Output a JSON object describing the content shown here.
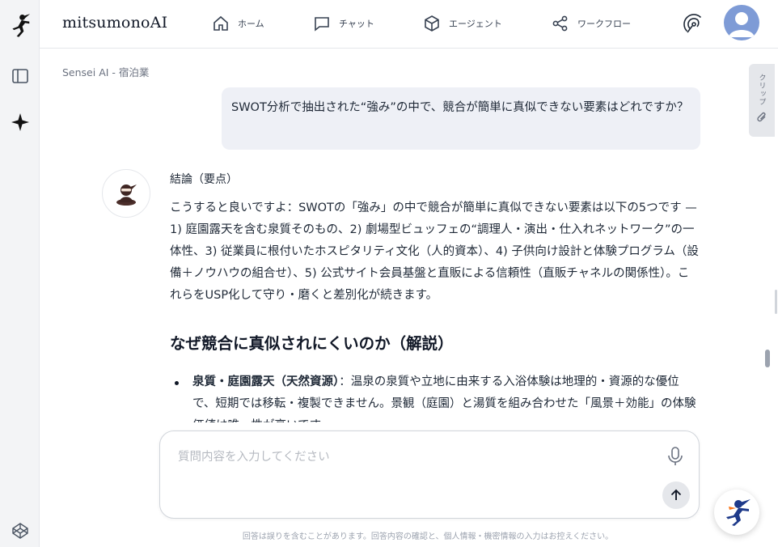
{
  "app": {
    "brand": "mitsumonoAI"
  },
  "nav": [
    {
      "label": "ホーム",
      "icon": "home-icon"
    },
    {
      "label": "チャット",
      "icon": "chat-icon"
    },
    {
      "label": "エージェント",
      "icon": "cube-icon"
    },
    {
      "label": "ワークフロー",
      "icon": "share-nodes-icon"
    }
  ],
  "breadcrumb": "Sensei AI - 宿泊業",
  "clip_tab": {
    "label": "クリップ"
  },
  "user_message": "SWOT分析で抽出された“強み”の中で、競合が簡単に真似できない要素はどれですか？",
  "answer": {
    "lead": "結論（要点）",
    "paragraph": "こうすると良いですよ：SWOTの「強み」の中で競合が簡単に真似できない要素は以下の5つです — 1) 庭園露天を含む泉質そのもの、2) 劇場型ビュッフェの“調理人・演出・仕入れネットワーク”の一体性、3) 従業員に根付いたホスピタリティ文化（人的資本）、4) 子供向け設計と体験プログラム（設備＋ノウハウの組合せ）、5) 公式サイト会員基盤と直販による信頼性（直販チャネルの関係性）。これらをUSP化して守り・磨くと差別化が続きます。",
    "heading": "なぜ競合に真似されにくいのか（解説）",
    "bullets": [
      {
        "title": "泉質・庭園露天（天然資源）",
        "text": "：温泉の泉質や立地に由来する入浴体験は地理的・資源的な優位で、短期では移転・複製できません。景観（庭園）と湯質を組み合わせた「風景＋効能」の体験価値は唯一性が高いです。"
      }
    ]
  },
  "composer": {
    "placeholder": "質問内容を入力してください"
  },
  "disclaimer": "回答は誤りを含むことがあります。回答内容の確認と、個人情報・機密情報の入力はお控えください。",
  "colors": {
    "accent": "#1e3a8a",
    "bubble": "#eef0f6",
    "rail": "#f3f4f6"
  }
}
